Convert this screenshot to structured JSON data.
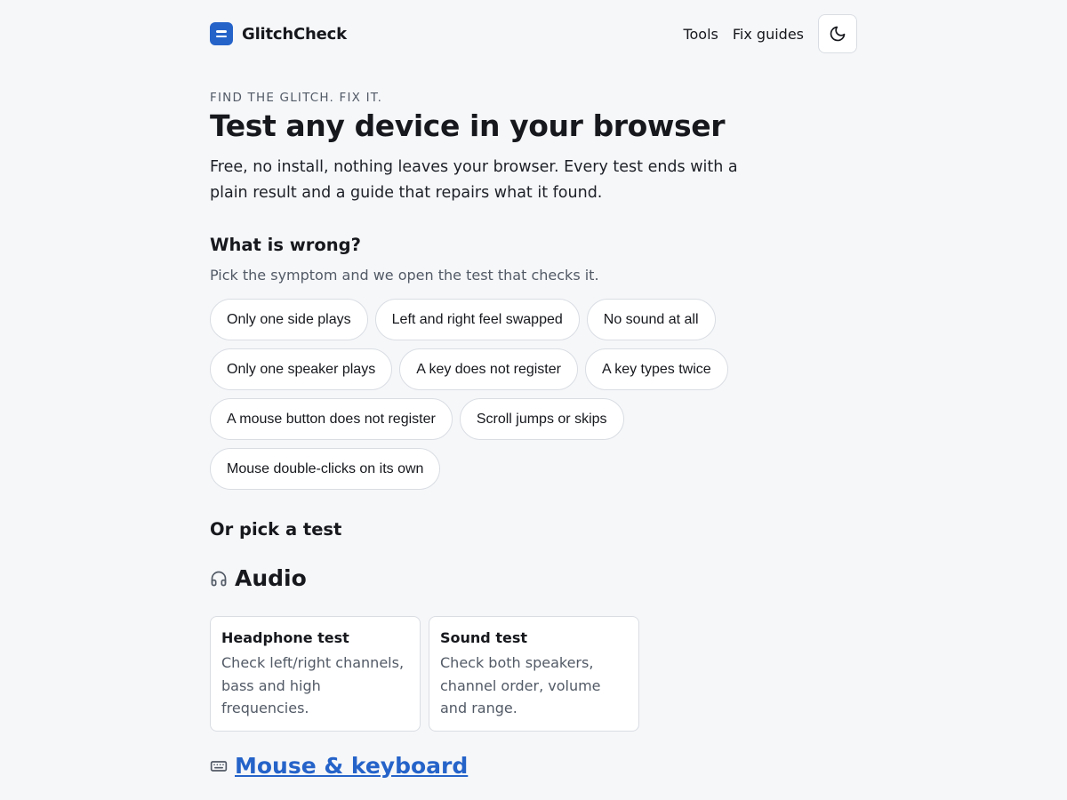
{
  "colors": {
    "accent": "#2563c9",
    "background": "#f6f7f9",
    "text": "#16181d",
    "muted": "#525a66",
    "border": "#d9dde3"
  },
  "header": {
    "brand": "GlitchCheck",
    "logo_icon": "equals-bars-icon",
    "nav": [
      "Tools",
      "Fix guides"
    ],
    "theme_toggle_icon": "moon-icon"
  },
  "hero": {
    "eyebrow": "FIND THE GLITCH. FIX IT.",
    "title": "Test any device in your browser",
    "subtitle": "Free, no install, nothing leaves your browser. Every test ends with a plain result and a guide that repairs what it found."
  },
  "symptoms": {
    "title": "What is wrong?",
    "help": "Pick the symptom and we open the test that checks it.",
    "chips": [
      "Only one side plays",
      "Left and right feel swapped",
      "No sound at all",
      "Only one speaker plays",
      "A key does not register",
      "A key types twice",
      "A mouse button does not register",
      "Scroll jumps or skips",
      "Mouse double-clicks on its own"
    ]
  },
  "tests": {
    "title": "Or pick a test",
    "categories": [
      {
        "label": "Audio",
        "icon": "headphones-icon",
        "cards": [
          {
            "title": "Headphone test",
            "desc": "Check left/right channels, bass and high frequencies."
          },
          {
            "title": "Sound test",
            "desc": "Check both speakers, channel order, volume and range."
          }
        ]
      },
      {
        "label": "Mouse & keyboard",
        "icon": "keyboard-icon"
      }
    ]
  }
}
